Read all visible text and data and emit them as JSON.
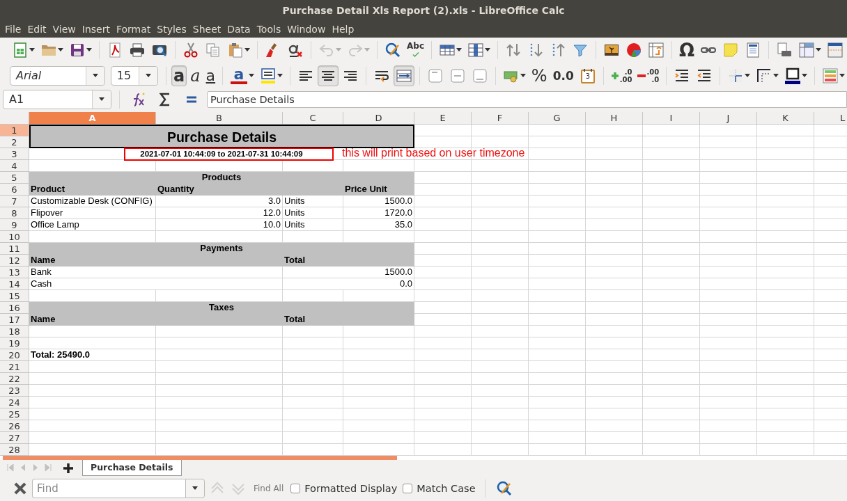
{
  "window": {
    "title": "Purchase Detail Xls Report (2).xls - LibreOffice Calc"
  },
  "menu_bar": [
    "File",
    "Edit",
    "View",
    "Insert",
    "Format",
    "Styles",
    "Sheet",
    "Data",
    "Tools",
    "Window",
    "Help"
  ],
  "standard_toolbar": {
    "undo": {
      "disabled": true
    },
    "redo": {
      "disabled": true
    },
    "spelling": {
      "glyph": "Abc"
    },
    "special_character": {
      "glyph": "Ω"
    }
  },
  "formatting_toolbar": {
    "font_name": {
      "value": "Arial"
    },
    "font_size": {
      "value": "15"
    },
    "bold": {
      "glyph": "a",
      "pressed": true
    },
    "italic": {
      "glyph": "a",
      "pressed": false
    },
    "underline": {
      "glyph": "a",
      "pressed": false
    },
    "font_color": {
      "glyph": "a"
    },
    "align_left": {
      "pressed": false
    },
    "align_center": {
      "pressed": true
    },
    "align_right": {
      "pressed": false
    },
    "wrap_text": {
      "pressed": false
    },
    "merge_center": {
      "pressed": true
    },
    "percent": {
      "glyph": "%"
    },
    "number": {
      "glyph": "0.0"
    },
    "date": {
      "glyph": "3"
    },
    "add_decimal": {
      "glyphs": [
        ".0",
        ".00"
      ]
    },
    "delete_decimal": {
      "glyphs": [
        ".00",
        ".0"
      ]
    }
  },
  "formula_bar": {
    "name_box": "A1",
    "formula": "Purchase Details"
  },
  "column_headers": [
    {
      "label": "A",
      "selected": true
    },
    {
      "label": "B",
      "selected": false
    },
    {
      "label": "C",
      "selected": false
    },
    {
      "label": "D",
      "selected": false
    },
    {
      "label": "E",
      "selected": false
    },
    {
      "label": "F",
      "selected": false
    },
    {
      "label": "G",
      "selected": false
    },
    {
      "label": "H",
      "selected": false
    },
    {
      "label": "I",
      "selected": false
    },
    {
      "label": "J",
      "selected": false
    },
    {
      "label": "K",
      "selected": false
    },
    {
      "label": "L",
      "selected": false
    }
  ],
  "row_headers": [
    {
      "label": "1",
      "selected": true
    },
    {
      "label": "2",
      "selected": false
    },
    {
      "label": "3",
      "selected": false
    },
    {
      "label": "4",
      "selected": false
    },
    {
      "label": "5",
      "selected": false
    },
    {
      "label": "6",
      "selected": false
    },
    {
      "label": "7",
      "selected": false
    },
    {
      "label": "8",
      "selected": false
    },
    {
      "label": "9",
      "selected": false
    },
    {
      "label": "10",
      "selected": false
    },
    {
      "label": "11",
      "selected": false
    },
    {
      "label": "12",
      "selected": false
    },
    {
      "label": "13",
      "selected": false
    },
    {
      "label": "14",
      "selected": false
    },
    {
      "label": "15",
      "selected": false
    },
    {
      "label": "16",
      "selected": false
    },
    {
      "label": "17",
      "selected": false
    },
    {
      "label": "18",
      "selected": false
    },
    {
      "label": "19",
      "selected": false
    },
    {
      "label": "20",
      "selected": false
    },
    {
      "label": "21",
      "selected": false
    },
    {
      "label": "22",
      "selected": false
    },
    {
      "label": "23",
      "selected": false
    },
    {
      "label": "24",
      "selected": false
    },
    {
      "label": "25",
      "selected": false
    },
    {
      "label": "26",
      "selected": false
    },
    {
      "label": "27",
      "selected": false
    },
    {
      "label": "28",
      "selected": false
    }
  ],
  "sheet": {
    "rows": [
      {
        "kind": "title",
        "shaded": true,
        "cells": {
          "a": "Purchase Details"
        }
      },
      {
        "kind": "band",
        "shaded": false,
        "cells": {
          "a": "2021-07-01 10:44:09 to 2021-07-31 10:44:09"
        }
      },
      {
        "kind": "blank"
      },
      {
        "kind": "band",
        "shaded": true,
        "cells": {
          "a": "Products"
        }
      },
      {
        "kind": "quad",
        "shaded": true,
        "bold": true,
        "cells": {
          "a": "Product",
          "b": "Quantity",
          "d": "Price Unit"
        }
      },
      {
        "kind": "quad",
        "shaded": false,
        "bold": false,
        "cells": {
          "a": "Customizable Desk (CONFIG)",
          "b": "3.0",
          "c": "Units",
          "d": "1500.0"
        }
      },
      {
        "kind": "quad",
        "shaded": false,
        "bold": false,
        "cells": {
          "a": "Flipover",
          "b": "12.0",
          "c": "Units",
          "d": "1720.0"
        }
      },
      {
        "kind": "quad",
        "shaded": false,
        "bold": false,
        "cells": {
          "a": "Office Lamp",
          "b": "10.0",
          "c": "Units",
          "d": "35.0"
        }
      },
      {
        "kind": "blank"
      },
      {
        "kind": "band",
        "shaded": true,
        "cells": {
          "a": "Payments"
        }
      },
      {
        "kind": "halves",
        "shaded": true,
        "bold": true,
        "cells": {
          "a": "Name",
          "c": "Total"
        }
      },
      {
        "kind": "halves",
        "shaded": false,
        "bold": false,
        "cells": {
          "a": "Bank",
          "c": "1500.0"
        }
      },
      {
        "kind": "halves",
        "shaded": false,
        "bold": false,
        "cells": {
          "a": "Cash",
          "c": "0.0"
        }
      },
      {
        "kind": "blank"
      },
      {
        "kind": "band",
        "shaded": true,
        "cells": {
          "a": "Taxes"
        }
      },
      {
        "kind": "halves",
        "shaded": true,
        "bold": true,
        "cells": {
          "a": "Name",
          "c": "Total"
        }
      },
      {
        "kind": "blank"
      },
      {
        "kind": "blank"
      },
      {
        "kind": "quad",
        "shaded": false,
        "bold": true,
        "cells": {
          "a": "Total:  25490.0"
        }
      },
      {
        "kind": "blank"
      },
      {
        "kind": "blank"
      },
      {
        "kind": "blank"
      },
      {
        "kind": "blank"
      },
      {
        "kind": "blank"
      },
      {
        "kind": "blank"
      },
      {
        "kind": "blank"
      },
      {
        "kind": "blank"
      }
    ],
    "annotation": {
      "text": "this will print based on user timezone"
    }
  },
  "sheet_tabs": {
    "navigation_disabled": true,
    "tabs": [
      {
        "label": "Purchase Details",
        "selected": true
      }
    ]
  },
  "find_toolbar": {
    "find": {
      "placeholder": "Find"
    },
    "previous": {
      "disabled": true
    },
    "next": {
      "disabled": true
    },
    "find_all": {
      "label": "Find All",
      "disabled": true
    },
    "options": [
      {
        "label": "Formatted Display",
        "checked": false
      },
      {
        "label": "Match Case",
        "checked": false
      }
    ]
  }
}
